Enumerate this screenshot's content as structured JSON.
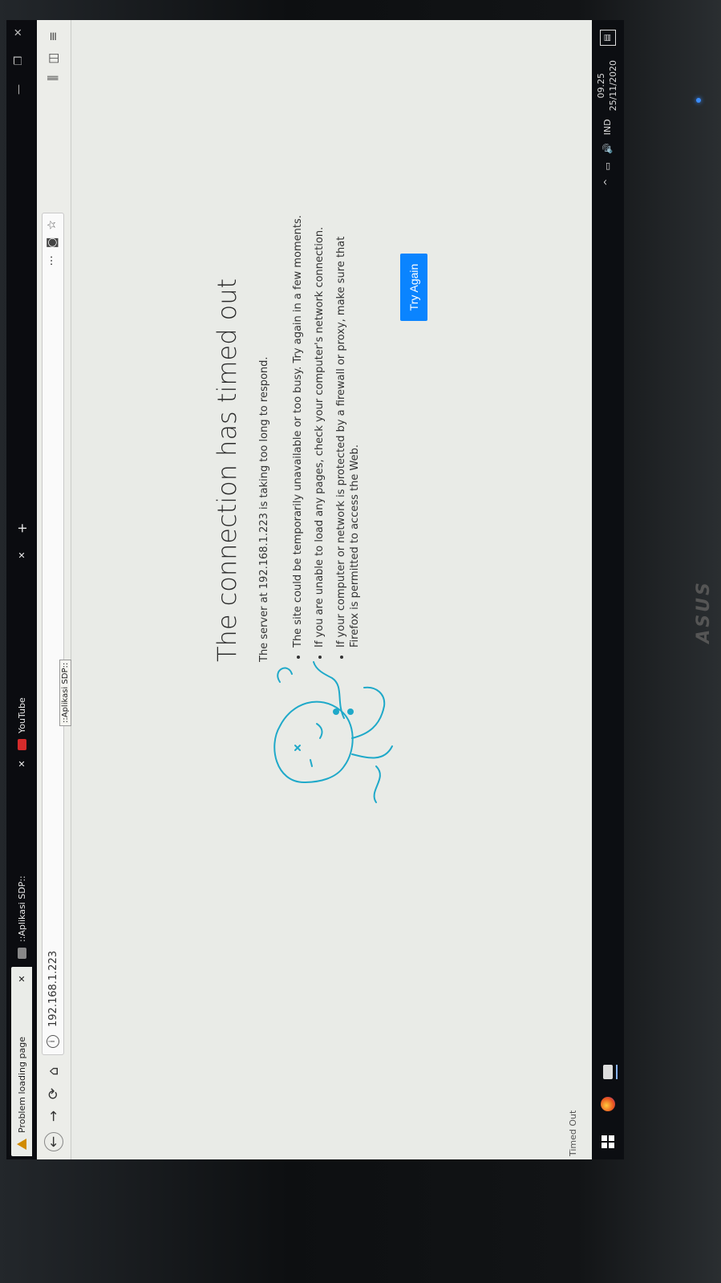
{
  "tabs": {
    "active_title": "Problem loading page",
    "close_glyph": "✕",
    "second_title": "::Aplikasi SDP::",
    "third_title": "YouTube",
    "new_tab_glyph": "+",
    "tooltip": "::Aplikasi SDP::"
  },
  "window": {
    "minimize": "—",
    "restore": "❐",
    "close": "✕"
  },
  "nav": {
    "back": "←",
    "forward": "→",
    "reload": "⟳",
    "home": "⌂",
    "url": "192.168.1.223",
    "more": "···",
    "pocket": "◙",
    "star": "☆",
    "library": "⫼",
    "sidebar": "◫",
    "menu": "≡"
  },
  "error": {
    "title": "The connection has timed out",
    "description": "The server at 192.168.1.223 is taking too long to respond.",
    "reasons": [
      "The site could be temporarily unavailable or too busy. Try again in a few moments.",
      "If you are unable to load any pages, check your computer's network connection.",
      "If your computer or network is protected by a firewall or proxy, make sure that Firefox is permitted to access the Web."
    ],
    "button": "Try Again"
  },
  "status": "Timed Out",
  "taskbar": {
    "tray_chevron": "^",
    "volume": "🔊",
    "language": "IND",
    "time": "09.25",
    "date": "25/11/2020",
    "notification": "▤"
  },
  "monitor": {
    "brand": "ASUS"
  },
  "colors": {
    "accent": "#0a84ff",
    "dino": "#1fa9c9"
  }
}
